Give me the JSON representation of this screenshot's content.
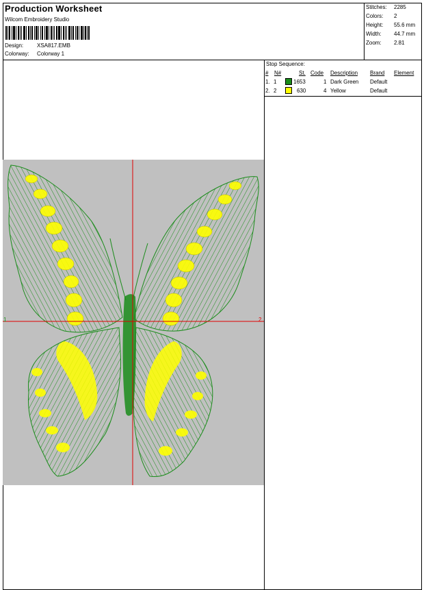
{
  "header": {
    "title": "Production Worksheet",
    "software": "Wilcom Embroidery Studio",
    "design_label": "Design:",
    "design_value": "XSA817.EMB",
    "colorway_label": "Colorway:",
    "colorway_value": "Colorway 1"
  },
  "stats": [
    {
      "label": "Stitches:",
      "value": "2285"
    },
    {
      "label": "Colors:",
      "value": "2"
    },
    {
      "label": "Height:",
      "value": "55.6 mm"
    },
    {
      "label": "Width:",
      "value": "44.7 mm"
    },
    {
      "label": "Zoom:",
      "value": "2.81"
    }
  ],
  "stop_sequence": {
    "title": "Stop Sequence:",
    "headers": {
      "hash": "#",
      "n": "N#",
      "st": "St.",
      "code": "Code",
      "description": "Description",
      "brand": "Brand",
      "element": "Element"
    },
    "rows": [
      {
        "num": "1.",
        "n": "1",
        "color": "#1a8c1a",
        "st": "1653",
        "code": "1",
        "description": "Dark Green",
        "brand": "Default",
        "element": ""
      },
      {
        "num": "2.",
        "n": "2",
        "color": "#ffff00",
        "st": "630",
        "code": "4",
        "description": "Yellow",
        "brand": "Default",
        "element": ""
      }
    ]
  },
  "design_preview": {
    "background": "#c0c0c0",
    "crosshair_color": "#e00000",
    "marker_left": "1",
    "marker_right": "2",
    "thread_colors": [
      "#1a8c1a",
      "#ffff00"
    ]
  }
}
